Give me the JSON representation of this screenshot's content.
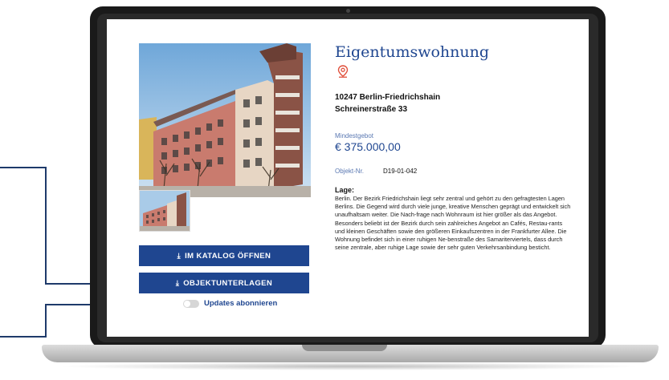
{
  "listing": {
    "title": "Eigentumswohnung",
    "address_line1": "10247 Berlin-Friedrichshain",
    "address_line2": "Schreinerstraße 33",
    "min_bid_label": "Mindestgebot",
    "min_bid_value": "€ 375.000,00",
    "object_no_label": "Objekt-Nr.",
    "object_no_value": "D19-01-042",
    "location_heading": "Lage:",
    "location_text": "Berlin. Der Bezirk Friedrichshain liegt sehr zentral und gehört zu den gefragtesten Lagen Berlins. Die Gegend wird durch viele junge, kreative Menschen geprägt und entwickelt sich unaufhaltsam weiter. Die Nach-frage nach Wohnraum ist hier größer als das Angebot. Besonders beliebt ist der Bezirk durch sein zahlreiches Angebot an Cafés, Restau-rants und kleinen Geschäften sowie den größeren Einkaufszentren in der Frankfurter Allee. Die Wohnung befindet sich in einer ruhigen Ne-benstraße des Samariterviertels, dass durch seine zentrale, aber ruhige Lage sowie der sehr guten Verkehrsanbindung besticht."
  },
  "actions": {
    "catalog_button": "IM KATALOG ÖFFNEN",
    "documents_button": "OBJEKTUNTERLAGEN",
    "subscribe_label": "Updates abonnieren",
    "subscribe_on": false
  },
  "icons": {
    "location": "map-pin-icon",
    "download": "download-icon"
  },
  "colors": {
    "brand_blue": "#1f4690",
    "pin_red": "#e0503c",
    "callout": "#1e3a6a"
  }
}
